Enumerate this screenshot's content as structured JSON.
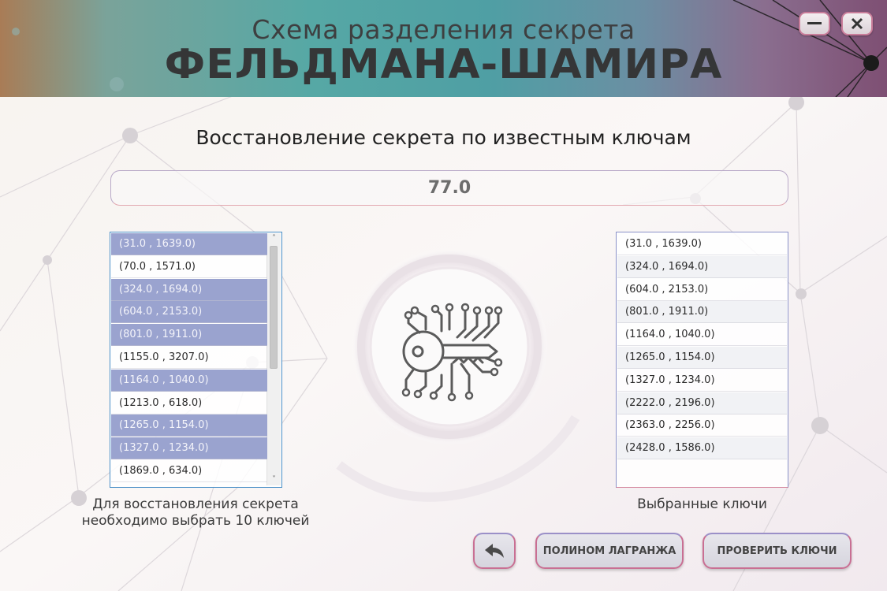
{
  "header": {
    "title_line1": "Схема разделения секрета",
    "title_line2": "ФЕЛЬДМАНА-ШАМИРА"
  },
  "window_controls": {
    "minimize_icon": "minimize-icon",
    "close_icon": "close-icon"
  },
  "main": {
    "subtitle": "Восстановление секрета по известным ключам",
    "secret_value": "77.0",
    "emblem_icon": "circuit-key-icon"
  },
  "available_keys": {
    "items": [
      {
        "label": "(31.0 , 1639.0)",
        "selected": true
      },
      {
        "label": "(70.0 , 1571.0)",
        "selected": false
      },
      {
        "label": "(324.0 , 1694.0)",
        "selected": true
      },
      {
        "label": "(604.0 , 2153.0)",
        "selected": true
      },
      {
        "label": "(801.0 , 1911.0)",
        "selected": true
      },
      {
        "label": "(1155.0 , 3207.0)",
        "selected": false
      },
      {
        "label": "(1164.0 , 1040.0)",
        "selected": true
      },
      {
        "label": "(1213.0 , 618.0)",
        "selected": false
      },
      {
        "label": "(1265.0 , 1154.0)",
        "selected": true
      },
      {
        "label": "(1327.0 , 1234.0)",
        "selected": true
      },
      {
        "label": "(1869.0 , 634.0)",
        "selected": false
      }
    ],
    "caption": "Для восстановления секрета необходимо выбрать 10 ключей"
  },
  "selected_keys": {
    "items": [
      "(31.0 , 1639.0)",
      "(324.0 , 1694.0)",
      "(604.0 , 2153.0)",
      "(801.0 , 1911.0)",
      "(1164.0 , 1040.0)",
      "(1265.0 , 1154.0)",
      "(1327.0 , 1234.0)",
      "(2222.0 , 2196.0)",
      "(2363.0 , 2256.0)",
      "(2428.0 , 1586.0)"
    ],
    "caption": "Выбранные ключи"
  },
  "buttons": {
    "back_icon": "back-arrow-icon",
    "lagrange": "ПОЛИНОМ ЛАГРАНЖА",
    "verify": "ПРОВЕРИТЬ КЛЮЧИ"
  }
}
